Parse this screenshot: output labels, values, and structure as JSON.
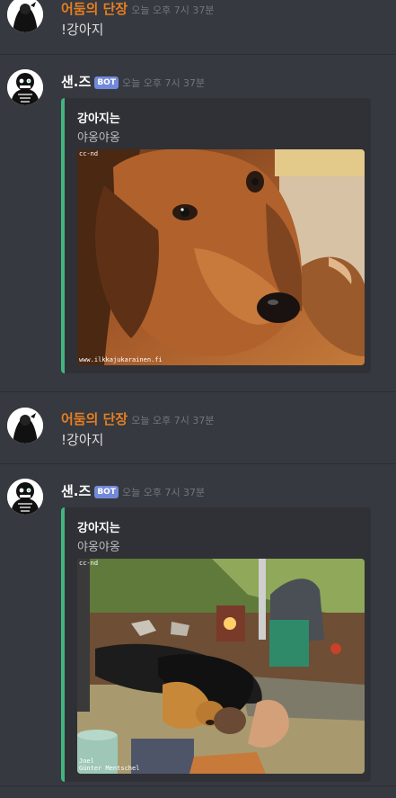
{
  "messages": [
    {
      "username": "어둠의 단장",
      "timestamp": "오늘 오후 7시 37분",
      "text": "!강아지"
    },
    {
      "username": "샌.즈",
      "bot_tag": "BOT",
      "timestamp": "오늘 오후 7시 37분",
      "embed": {
        "title": "강아지는",
        "description": "야옹야옹",
        "watermark_top": "cc-nd",
        "watermark_bottom": "www.ilkkajukarainen.fi"
      }
    },
    {
      "username": "어둠의 단장",
      "timestamp": "오늘 오후 7시 37분",
      "text": "!강아지"
    },
    {
      "username": "샌.즈",
      "bot_tag": "BOT",
      "timestamp": "오늘 오후 7시 37분",
      "embed": {
        "title": "강아지는",
        "description": "야옹야옹",
        "watermark_top": "cc-nd",
        "watermark_bottom_1": "Joel",
        "watermark_bottom_2": "Günter Mentschel"
      }
    }
  ],
  "colors": {
    "background": "#36393f",
    "user_name": "#e67e22",
    "bot_name": "#ffffff",
    "embed_bg": "#2f3136",
    "embed_accent": "#43b581",
    "bot_badge": "#7289da",
    "timestamp": "#72767d"
  },
  "icons": {
    "user_avatar": "dark-cloaked-figure-avatar",
    "bot_avatar": "skeleton-avatar"
  }
}
